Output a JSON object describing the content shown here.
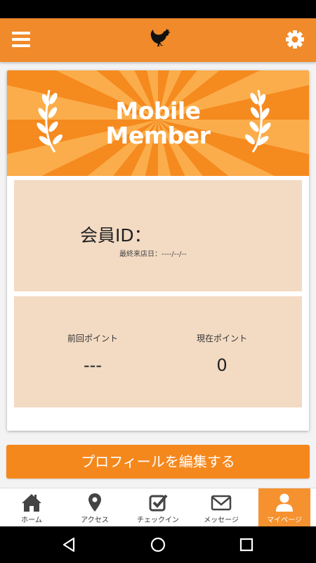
{
  "header": {
    "menu_icon": "hamburger-menu-icon",
    "logo_icon": "rooster-logo-icon",
    "settings_icon": "gear-icon"
  },
  "banner": {
    "title_line1": "Mobile",
    "title_line2": "Member",
    "colors": {
      "light": "#fbad4b",
      "dark": "#f58a1f"
    }
  },
  "member": {
    "id_label": "会員ID：",
    "last_visit_label": "最終来店日：",
    "last_visit_value": "----/--/--"
  },
  "points": {
    "previous_label": "前回ポイント",
    "previous_value": "---",
    "current_label": "現在ポイント",
    "current_value": "0"
  },
  "edit_profile_label": "プロフィールを編集する",
  "tabs": [
    {
      "label": "ホーム",
      "icon": "home-icon"
    },
    {
      "label": "アクセス",
      "icon": "map-pin-icon"
    },
    {
      "label": "チェックイン",
      "icon": "checkbox-icon"
    },
    {
      "label": "メッセージ",
      "icon": "envelope-icon"
    },
    {
      "label": "マイページ",
      "icon": "user-icon",
      "active": true
    }
  ],
  "accent_color": "#f08a2a"
}
